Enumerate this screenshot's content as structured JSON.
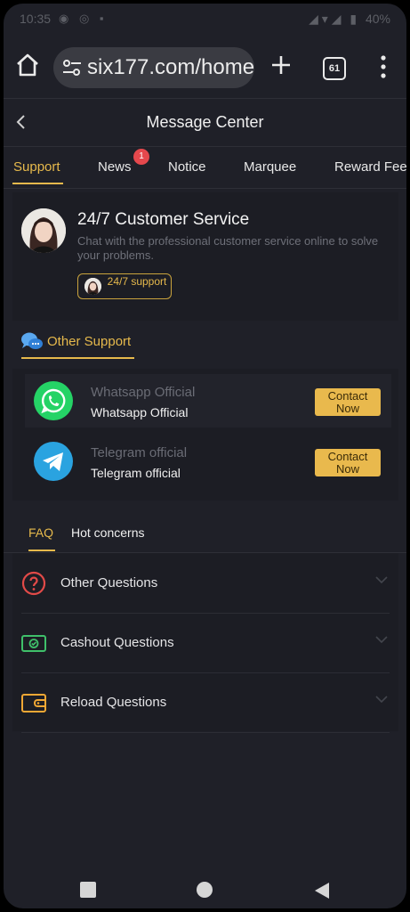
{
  "status_bar": {
    "time": "10:35",
    "battery": "40%"
  },
  "browser": {
    "url": "six177.com/home",
    "tab_count": "61"
  },
  "header": {
    "title": "Message Center"
  },
  "tabs": [
    {
      "label": "Support"
    },
    {
      "label": "News",
      "badge": "1"
    },
    {
      "label": "Notice"
    },
    {
      "label": "Marquee"
    },
    {
      "label": "Reward Feedback"
    }
  ],
  "customer_service": {
    "title": "24/7 Customer Service",
    "description": "Chat with the professional customer service online to solve your problems.",
    "support_label": "24/7 support"
  },
  "other_support": {
    "label": "Other Support",
    "contacts": [
      {
        "name": "Whatsapp Official",
        "subtitle": "Whatsapp Official",
        "button": "Contact Now",
        "icon": "whatsapp-icon"
      },
      {
        "name": "Telegram official",
        "subtitle": "Telegram official",
        "button": "Contact Now",
        "icon": "telegram-icon"
      }
    ]
  },
  "faq": {
    "tabs": [
      {
        "label": "FAQ"
      },
      {
        "label": "Hot concerns"
      }
    ],
    "items": [
      {
        "label": "Other Questions",
        "icon": "question-circle-icon"
      },
      {
        "label": "Cashout Questions",
        "icon": "cash-icon"
      },
      {
        "label": "Reload Questions",
        "icon": "wallet-icon"
      }
    ]
  },
  "colors": {
    "accent": "#e6b94c",
    "background": "#1f2028",
    "card": "#1c1d24",
    "whatsapp": "#25d366",
    "telegram": "#2aa3e0",
    "badge": "#e5484d"
  }
}
